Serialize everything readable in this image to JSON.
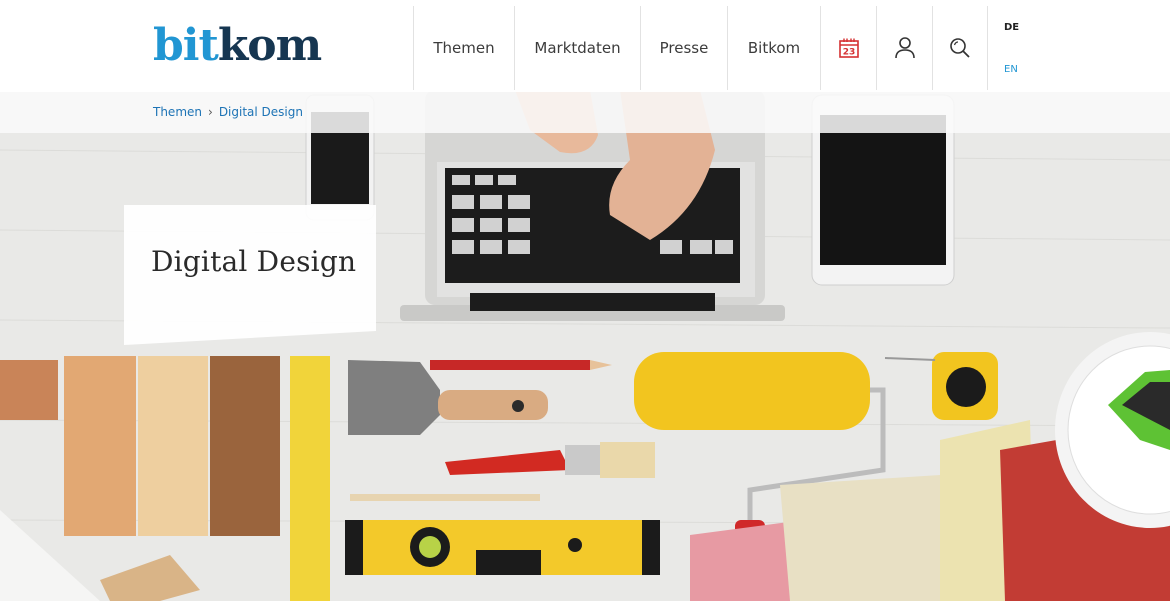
{
  "header": {
    "logo": {
      "part1": "bit",
      "part2": "kom"
    },
    "nav": [
      {
        "label": "Themen"
      },
      {
        "label": "Marktdaten"
      },
      {
        "label": "Presse"
      },
      {
        "label": "Bitkom"
      }
    ],
    "icons": [
      {
        "name": "calendar-icon",
        "text": "23"
      },
      {
        "name": "user-icon"
      },
      {
        "name": "search-icon"
      }
    ],
    "languages": {
      "de": "DE",
      "en": "EN"
    }
  },
  "breadcrumb": {
    "items": [
      "Themen",
      "Digital Design"
    ],
    "separator": "›"
  },
  "hero": {
    "title": "Digital Design"
  },
  "colors": {
    "brand_blue": "#2196d3",
    "brand_dark": "#163651",
    "calendar_red": "#d53032",
    "link": "#1d73b5"
  }
}
